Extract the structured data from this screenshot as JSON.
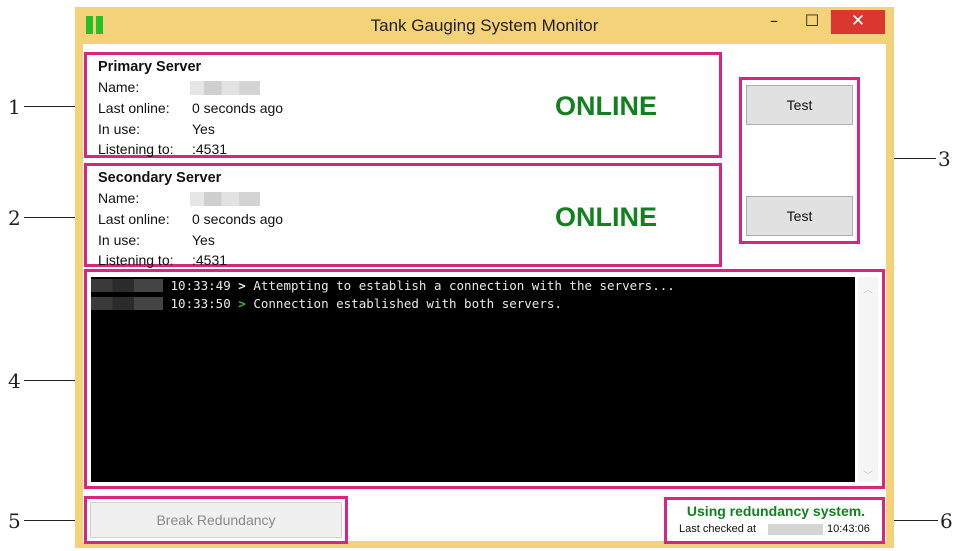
{
  "window": {
    "title": "Tank Gauging System Monitor",
    "controls": {
      "minimize": "–",
      "maximize": "☐",
      "close": "✕"
    }
  },
  "callouts": [
    "1",
    "2",
    "3",
    "4",
    "5",
    "6"
  ],
  "servers": {
    "primary": {
      "heading": "Primary Server",
      "name_label": "Name:",
      "last_online_label": "Last online:",
      "last_online": "0 seconds ago",
      "in_use_label": "In use:",
      "in_use": "Yes",
      "listening_label": "Listening to:",
      "listening": ":4531",
      "status": "ONLINE"
    },
    "secondary": {
      "heading": "Secondary Server",
      "name_label": "Name:",
      "last_online_label": "Last online:",
      "last_online": "0 seconds ago",
      "in_use_label": "In use:",
      "in_use": "Yes",
      "listening_label": "Listening to:",
      "listening": ":4531",
      "status": "ONLINE"
    }
  },
  "test_buttons": {
    "primary": "Test",
    "secondary": "Test"
  },
  "log": [
    {
      "time": "10:33:49",
      "arrow": ">",
      "message": "Attempting to establish a connection with the servers...",
      "arrow_color": "#e8e8e8"
    },
    {
      "time": "10:33:50",
      "arrow": ">",
      "message": "Connection established with both servers.",
      "arrow_color": "#2ec02e"
    }
  ],
  "break_button": "Break Redundancy",
  "redundancy": {
    "message": "Using redundancy system.",
    "last_checked_label": "Last checked at",
    "last_checked_time": "10:43:06"
  },
  "colors": {
    "accent": "#d6267f",
    "online": "#12801e",
    "frame": "#f3d27a",
    "close": "#d9372f"
  },
  "icons": {
    "app": "app-icon",
    "scroll_up": "chevron-up-icon",
    "scroll_down": "chevron-down-icon"
  }
}
